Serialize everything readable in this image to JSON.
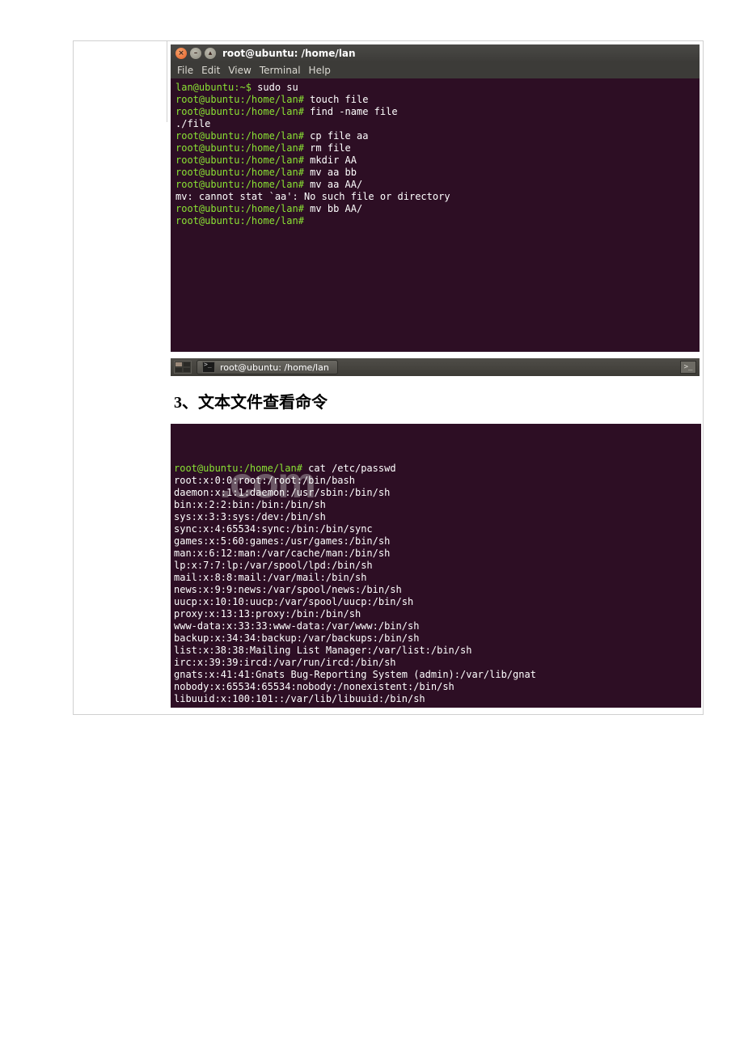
{
  "window": {
    "title": "root@ubuntu: /home/lan",
    "menus": [
      "File",
      "Edit",
      "View",
      "Terminal",
      "Help"
    ]
  },
  "terminal1": {
    "lines": [
      {
        "prompt": "lan@ubuntu:~$",
        "cmd": " sudo su"
      },
      {
        "prompt": "root@ubuntu:/home/lan#",
        "cmd": " touch file"
      },
      {
        "prompt": "root@ubuntu:/home/lan#",
        "cmd": " find -name file"
      },
      {
        "out": "./file"
      },
      {
        "prompt": "root@ubuntu:/home/lan#",
        "cmd": " cp file aa"
      },
      {
        "prompt": "root@ubuntu:/home/lan#",
        "cmd": " rm file"
      },
      {
        "prompt": "root@ubuntu:/home/lan#",
        "cmd": " mkdir AA"
      },
      {
        "prompt": "root@ubuntu:/home/lan#",
        "cmd": " mv aa bb"
      },
      {
        "prompt": "root@ubuntu:/home/lan#",
        "cmd": " mv aa AA/"
      },
      {
        "out": "mv: cannot stat `aa': No such file or directory"
      },
      {
        "prompt": "root@ubuntu:/home/lan#",
        "cmd": " mv bb AA/"
      },
      {
        "prompt": "root@ubuntu:/home/lan#",
        "cmd": " "
      }
    ]
  },
  "panel": {
    "task_label": "root@ubuntu: /home/lan"
  },
  "section_heading": "3、文本文件查看命令",
  "terminal2": {
    "lines": [
      "root@ubuntu:/home/lan# cat /etc/passwd",
      "root:x:0:0:root:/root:/bin/bash",
      "daemon:x:1:1:daemon:/usr/sbin:/bin/sh",
      "bin:x:2:2:bin:/bin:/bin/sh",
      "sys:x:3:3:sys:/dev:/bin/sh",
      "sync:x:4:65534:sync:/bin:/bin/sync",
      "games:x:5:60:games:/usr/games:/bin/sh",
      "man:x:6:12:man:/var/cache/man:/bin/sh",
      "lp:x:7:7:lp:/var/spool/lpd:/bin/sh",
      "mail:x:8:8:mail:/var/mail:/bin/sh",
      "news:x:9:9:news:/var/spool/news:/bin/sh",
      "uucp:x:10:10:uucp:/var/spool/uucp:/bin/sh",
      "proxy:x:13:13:proxy:/bin:/bin/sh",
      "www-data:x:33:33:www-data:/var/www:/bin/sh",
      "backup:x:34:34:backup:/var/backups:/bin/sh",
      "list:x:38:38:Mailing List Manager:/var/list:/bin/sh",
      "irc:x:39:39:ircd:/var/run/ircd:/bin/sh",
      "gnats:x:41:41:Gnats Bug-Reporting System (admin):/var/lib/gnat",
      "nobody:x:65534:65534:nobody:/nonexistent:/bin/sh",
      "libuuid:x:100:101::/var/lib/libuuid:/bin/sh"
    ]
  },
  "watermark": ".com"
}
